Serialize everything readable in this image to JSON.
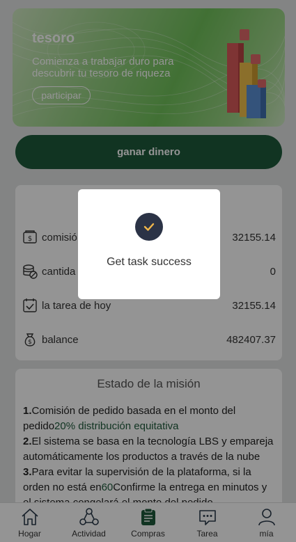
{
  "banner": {
    "title": "tesoro",
    "subtitle": "Comienza a trabajar duro para descubrir tu tesoro de riqueza",
    "button_label": "participar"
  },
  "earn_button": "ganar dinero",
  "stats": [
    {
      "icon": "commission-icon",
      "label": "comisió",
      "value": "32155.14"
    },
    {
      "icon": "coins-icon",
      "label": "cantida",
      "value": "0"
    },
    {
      "icon": "task-check-icon",
      "label": "la tarea de hoy",
      "value": "32155.14"
    },
    {
      "icon": "money-bag-icon",
      "label": "balance",
      "value": "482407.37"
    }
  ],
  "mission": {
    "title": "Estado de la misión",
    "p1_num": "1.",
    "p1_text": "Comisión de pedido basada en el monto del pedido",
    "p1_highlight": "20% distribución equitativa",
    "p2_num": "2.",
    "p2_text": "El sistema se basa en la tecnología LBS y empareja automáticamente los productos a través de la nube",
    "p3_num": "3.",
    "p3_text_a": "Para evitar la supervisión de la plataforma, si la orden no está en",
    "p3_highlight": "60",
    "p3_text_b": "Confirme la entrega en minutos y el sistema congelará el monto del pedido."
  },
  "nav": [
    {
      "icon": "home-icon",
      "label": "Hogar"
    },
    {
      "icon": "activity-icon",
      "label": "Actividad"
    },
    {
      "icon": "clipboard-icon",
      "label": "Compras"
    },
    {
      "icon": "chat-icon",
      "label": "Tarea"
    },
    {
      "icon": "user-icon",
      "label": "mía"
    }
  ],
  "modal": {
    "message": "Get task success"
  },
  "colors": {
    "primary": "#1e5b3b",
    "modal_icon_bg": "#2b3346",
    "check": "#f2b84b"
  }
}
